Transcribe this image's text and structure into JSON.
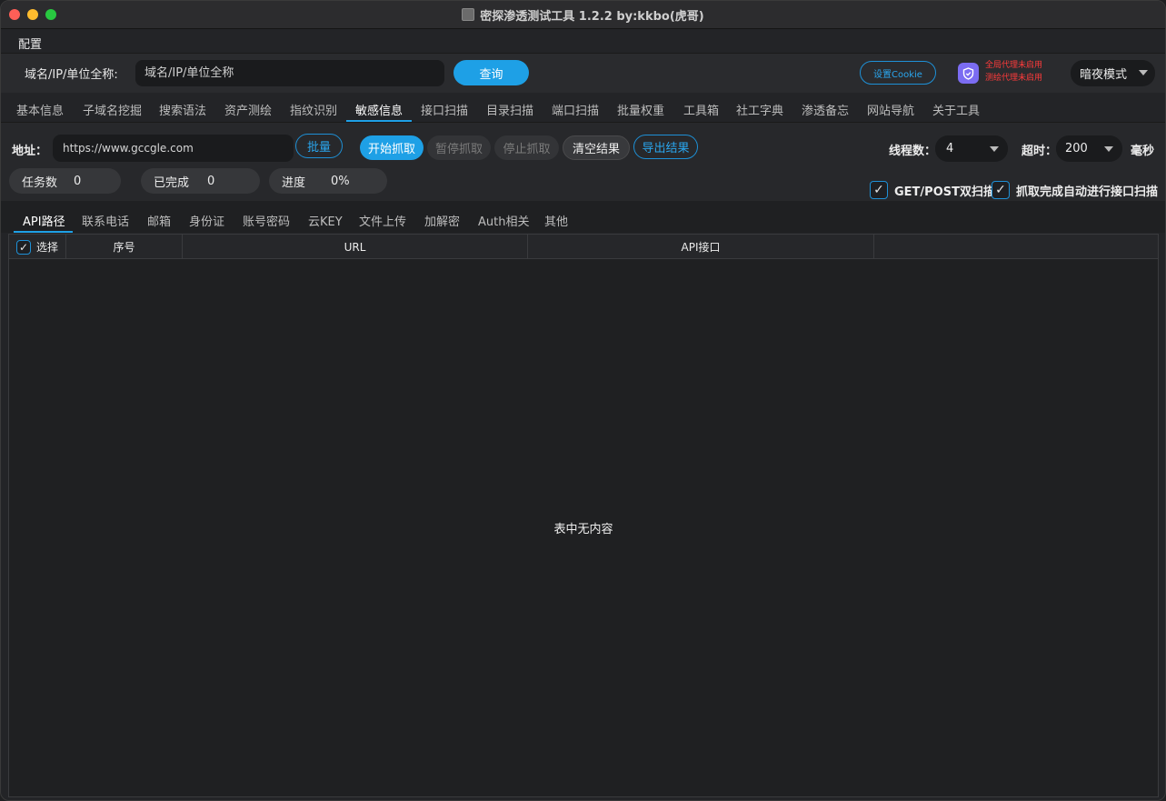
{
  "window": {
    "title": "密探渗透测试工具 1.2.2 by:kkbo(虎哥)"
  },
  "menu": {
    "config": "配置"
  },
  "search": {
    "label": "域名/IP/单位全称:",
    "placeholder": "域名/IP/单位全称",
    "query_button": "查询",
    "cookie_button": "设置Cookie",
    "proxy_global": "全局代理未启用",
    "proxy_test": "测绘代理未启用",
    "mode": "暗夜模式"
  },
  "main_tabs": [
    {
      "label": "基本信息"
    },
    {
      "label": "子域名挖掘"
    },
    {
      "label": "搜索语法"
    },
    {
      "label": "资产测绘"
    },
    {
      "label": "指纹识别"
    },
    {
      "label": "敏感信息",
      "active": true
    },
    {
      "label": "接口扫描"
    },
    {
      "label": "目录扫描"
    },
    {
      "label": "端口扫描"
    },
    {
      "label": "批量权重"
    },
    {
      "label": "工具箱"
    },
    {
      "label": "社工字典"
    },
    {
      "label": "渗透备忘"
    },
    {
      "label": "网站导航"
    },
    {
      "label": "关于工具"
    }
  ],
  "controls": {
    "address_label": "地址：",
    "address_value": "https://www.gccgle.com",
    "batch_button": "批量",
    "start_button": "开始抓取",
    "pause_button": "暂停抓取",
    "stop_button": "停止抓取",
    "clear_button": "清空结果",
    "export_button": "导出结果",
    "thread_label": "线程数：",
    "thread_value": "4",
    "timeout_label": "超时：",
    "timeout_value": "200",
    "timeout_unit": "毫秒",
    "tasks_label": "任务数",
    "tasks_value": "0",
    "done_label": "已完成",
    "done_value": "0",
    "progress_label": "进度",
    "progress_value": "0%",
    "getpost_label": "GET/POST双扫描",
    "getpost_checked": true,
    "auto_label": "抓取完成自动进行接口扫描",
    "auto_checked": true
  },
  "sub_tabs": [
    {
      "label": "API路径",
      "active": true
    },
    {
      "label": "联系电话"
    },
    {
      "label": "邮箱"
    },
    {
      "label": "身份证"
    },
    {
      "label": "账号密码"
    },
    {
      "label": "云KEY"
    },
    {
      "label": "文件上传"
    },
    {
      "label": "加解密"
    },
    {
      "label": "Auth相关"
    },
    {
      "label": "其他"
    }
  ],
  "table": {
    "columns": {
      "select": "选择",
      "index": "序号",
      "url": "URL",
      "api": "API接口"
    },
    "empty_text": "表中无内容"
  },
  "colors": {
    "accent": "#1ea0e6",
    "warning": "#ff3b3b",
    "shield": "#7b6cf2"
  }
}
